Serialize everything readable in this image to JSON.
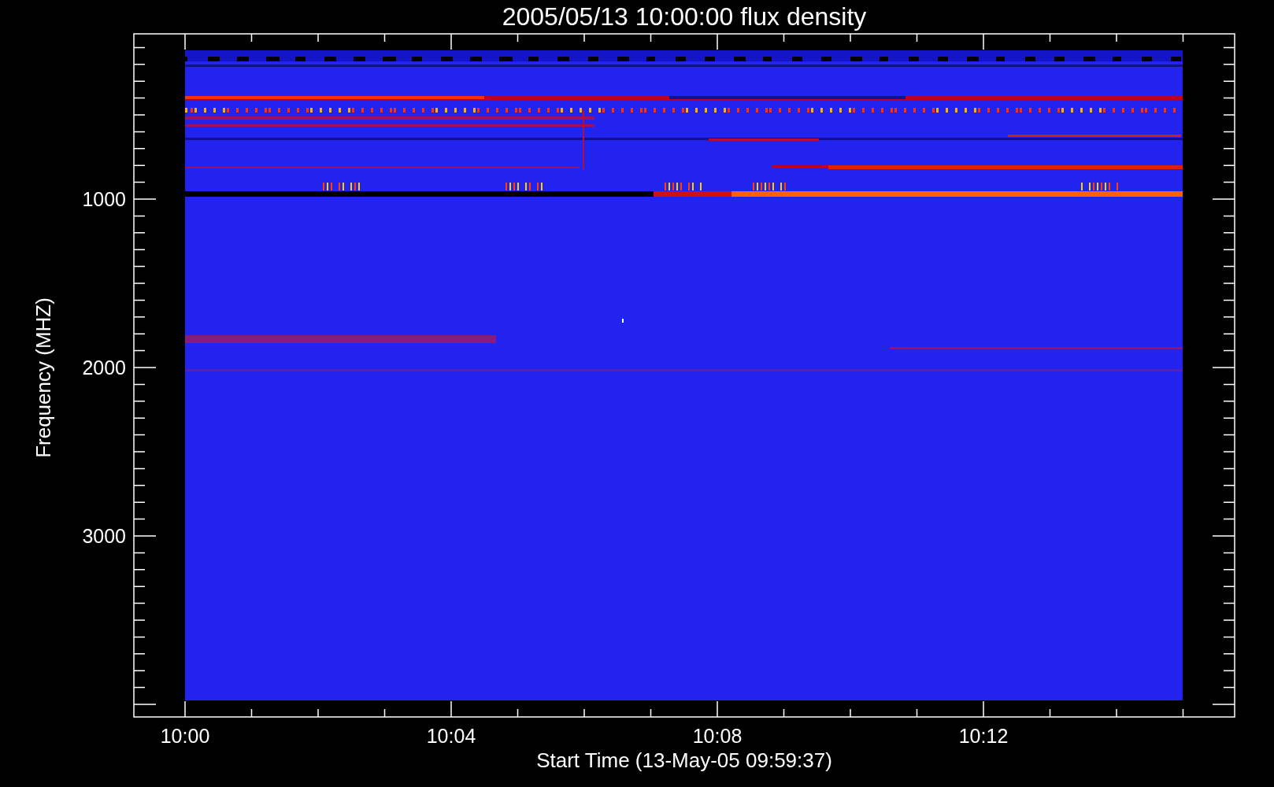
{
  "plot": {
    "title": "2005/05/13 10:00:00 flux density",
    "ylabel": "Frequency (MHZ)",
    "xlabel": "Start Time (13-May-05 09:59:37)",
    "yticks": [
      "1000",
      "2000",
      "3000"
    ],
    "xticks": [
      "10:00",
      "10:04",
      "10:08",
      "10:12"
    ]
  }
}
